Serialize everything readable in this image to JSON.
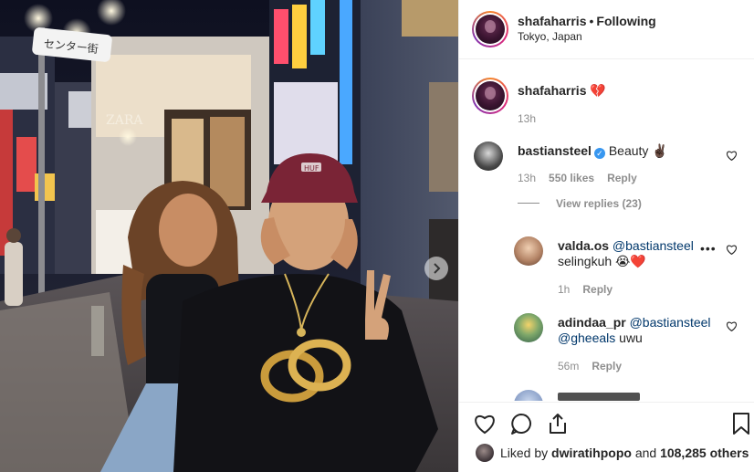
{
  "post": {
    "username": "shafaharris",
    "separator": "•",
    "follow_state": "Following",
    "location": "Tokyo, Japan"
  },
  "caption": {
    "username": "shafaharris",
    "text": "💔",
    "time": "13h"
  },
  "comments": [
    {
      "username": "bastiansteel",
      "verified": true,
      "text": "Beauty ✌🏿",
      "time": "13h",
      "likes": "550 likes",
      "reply_label": "Reply",
      "view_replies": "View replies (23)"
    }
  ],
  "replies": [
    {
      "username": "valda.os",
      "mention": "@bastiansteel",
      "text": "selingkuh 😭❤️",
      "time": "1h",
      "reply_label": "Reply",
      "more": "•••"
    },
    {
      "username": "adindaa_pr",
      "mention": "@bastiansteel",
      "mention2": "@gheeals",
      "text": "uwu",
      "time": "56m",
      "reply_label": "Reply"
    }
  ],
  "likes": {
    "prefix": "Liked by",
    "user": "dwiratihpopo",
    "conjunction": "and",
    "count": "108,285 others"
  },
  "photo": {
    "sign_text": "センター街",
    "shirt_brand": "HUF",
    "store_sign": "ZARA"
  },
  "colors": {
    "link": "#00376b",
    "muted": "#8e8e8e",
    "verified": "#3897f0"
  }
}
